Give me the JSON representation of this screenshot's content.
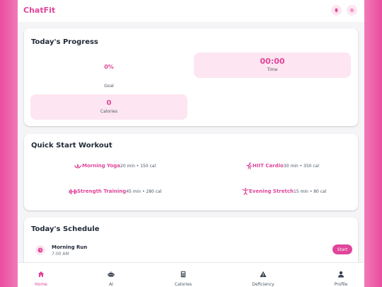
{
  "app": {
    "title": "ChatFit"
  },
  "header": {
    "icons": [
      "bell-icon",
      "gear-icon"
    ]
  },
  "progress": {
    "title": "Today's Progress",
    "goal_value": "0%",
    "goal_label": "Goal",
    "time_value": "00:00",
    "time_label": "Time",
    "calories_value": "0",
    "calories_label": "Calories"
  },
  "quick_start": {
    "title": "Quick Start Workout",
    "items": [
      {
        "name": "Morning Yoga",
        "meta": "20 min • 150 cal",
        "icon": "lotus-icon"
      },
      {
        "name": "HIIT Cardio",
        "meta": "30 min • 350 cal",
        "icon": "running-icon"
      },
      {
        "name": "Strength Training",
        "meta": "45 min • 280 cal",
        "icon": "dumbbell-icon"
      },
      {
        "name": "Evening Stretch",
        "meta": "15 min • 80 cal",
        "icon": "stretch-icon"
      }
    ]
  },
  "schedule": {
    "title": "Today's Schedule",
    "items": [
      {
        "name": "Morning Run",
        "time": "7:00 AM",
        "action": "Start",
        "icon": "clock-icon"
      }
    ]
  },
  "nav": {
    "items": [
      {
        "label": "Home",
        "icon": "home-icon",
        "active": true
      },
      {
        "label": "AI",
        "icon": "robot-icon",
        "active": false
      },
      {
        "label": "Calories",
        "icon": "calculator-icon",
        "active": false
      },
      {
        "label": "Deficiency",
        "icon": "warning-icon",
        "active": false
      },
      {
        "label": "Profile",
        "icon": "user-icon",
        "active": false
      }
    ]
  },
  "colors": {
    "accent": "#e0459a",
    "accent_light": "#fde6f1",
    "background": "#f5f5f7"
  }
}
